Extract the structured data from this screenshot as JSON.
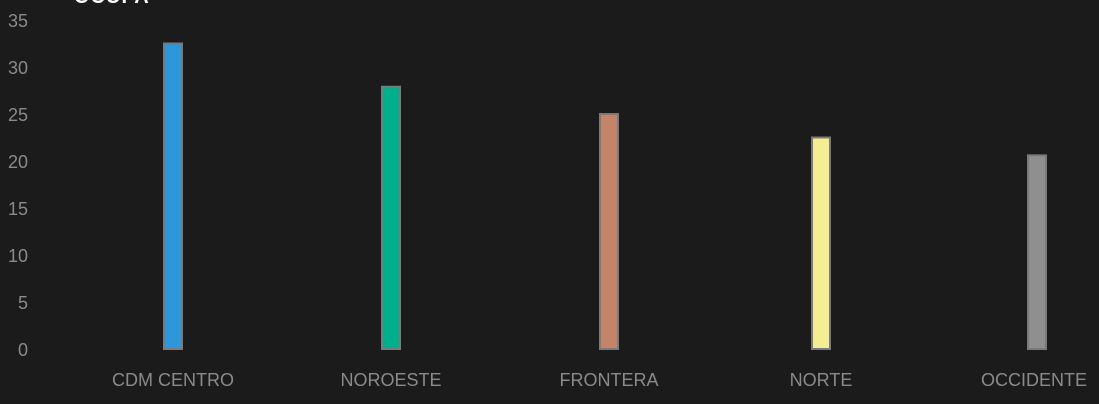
{
  "chart_data": {
    "type": "bar",
    "title": "OCUPA",
    "categories": [
      "CDM CENTRO",
      "NOROESTE",
      "FRONTERA",
      "NORTE",
      "OCCIDENTE"
    ],
    "values": [
      32.5,
      27.9,
      25.0,
      22.5,
      20.6
    ],
    "colors": [
      "#2e96da",
      "#00b08c",
      "#c4846a",
      "#f3ee93",
      "#8f8f8f"
    ],
    "yticks": [
      0,
      5,
      10,
      15,
      20,
      25,
      30,
      35
    ],
    "ylim": [
      0,
      35
    ],
    "xlabel": "",
    "ylabel": "",
    "grid": false,
    "bar_border_color": "#7a7a7a"
  }
}
